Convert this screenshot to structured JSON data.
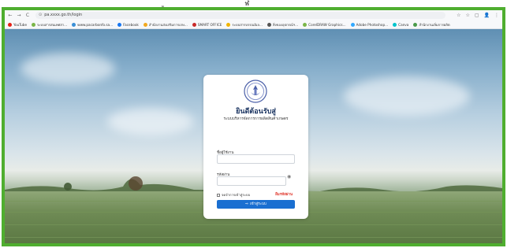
{
  "caption": {
    "left": "ู",
    "right": "ฬ"
  },
  "browser": {
    "url": "pa.xxxx.go.th/login",
    "nav": {
      "back": "←",
      "forward": "→",
      "reload": "C"
    },
    "right_icons": [
      "☆",
      "☆",
      "▢",
      "👤",
      "⋮"
    ],
    "bookmarks": [
      {
        "label": "YouTube",
        "color": "#e62117"
      },
      {
        "label": "ระบบสารสนเทศสา...",
        "color": "#7ab648"
      },
      {
        "label": "www.pacarbonfo.sa...",
        "color": "#3a8fd6"
      },
      {
        "label": "Facebook",
        "color": "#1877f2"
      },
      {
        "label": "สำนักงานส่งเสริมการเกษ...",
        "color": "#f2a81d"
      },
      {
        "label": "SMART OFFICE",
        "color": "#c92a2a"
      },
      {
        "label": "ระบบสารบรรณอิเล...",
        "color": "#f0b400"
      },
      {
        "label": "สิ่งของอุปกรณ์ฯ...",
        "color": "#555"
      },
      {
        "label": "CorelDRAW Graphics...",
        "color": "#7ab648"
      },
      {
        "label": "Adobe Photoshop...",
        "color": "#31a8ff"
      },
      {
        "label": "Canva",
        "color": "#00c4cc"
      },
      {
        "label": "สำนักงานเลิ่มการผลิต",
        "color": "#4a9b4a"
      }
    ]
  },
  "login": {
    "welcome": "ยินดีต้อนรับสู่",
    "subtitle": "ระบบบริหารจัดการการผลิตสินค้าเกษตร",
    "username_label": "ชื่อผู้ใช้งาน",
    "username_value": "",
    "password_label": "รหัสผ่าน",
    "password_value": "",
    "remember_label": "จดจำการเข้าสู่ระบบ",
    "forgot_label": "ลืมรหัสผ่าน",
    "login_button": "เข้าสู่ระบบ",
    "login_icon": "⇨"
  },
  "colors": {
    "frame": "#4fae2f",
    "accent": "#1a6fd1",
    "title": "#1f3864",
    "forgot": "#e0382d"
  }
}
